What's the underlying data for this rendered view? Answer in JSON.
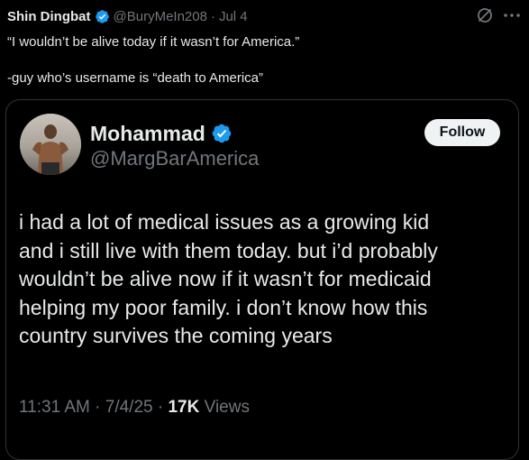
{
  "outer_tweet": {
    "author_name": "Shin Dingbat",
    "author_handle": "@BuryMeIn208",
    "separator": "·",
    "date": "Jul 4",
    "text_line1": "“I wouldn’t be alive today if it wasn’t for America.”",
    "text_line2": "-guy who’s username is “death to America”",
    "verified_icon": "verified-badge",
    "grok_icon": "grok-icon",
    "more_icon": "more-horizontal-icon"
  },
  "quoted_tweet": {
    "author_name": "Mohammad",
    "author_handle": "@MargBarAmerica",
    "follow_label": "Follow",
    "body_lines": [
      "i had a lot of medical issues as a growing kid",
      "and i still live with them today. but i’d probably",
      "wouldn’t be alive now if it wasn’t for medicaid",
      "helping my poor family. i don’t know how this",
      "country survives the coming years"
    ],
    "time": "11:31 AM",
    "separator": "·",
    "date": "7/4/25",
    "views_count": "17K",
    "views_label": "Views"
  },
  "colors": {
    "background": "#000000",
    "text_primary": "#e7e9ea",
    "text_secondary": "#71767b",
    "verified_blue": "#1d9bf0",
    "card_border": "#2f3336",
    "follow_button_bg": "#eff3f4"
  }
}
